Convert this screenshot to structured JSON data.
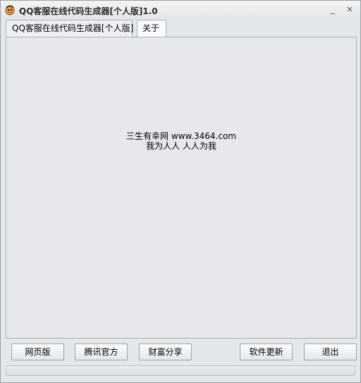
{
  "window": {
    "title": "QQ客服在线代码生成器[个人版]1.0",
    "minimize_glyph": "_",
    "close_glyph": "×"
  },
  "tabs": [
    {
      "label": "QQ客服在线代码生成器[个人版]",
      "selected": false
    },
    {
      "label": "关于",
      "selected": true
    }
  ],
  "about": {
    "line1": "三生有幸网 www.3464.com",
    "line2": "我为人人 人人为我"
  },
  "buttons": {
    "web": "网页版",
    "tencent": "腾讯官方",
    "wealth": "财富分享",
    "update": "软件更新",
    "exit": "退出"
  },
  "progress": {
    "value": 0
  },
  "icons": {
    "app": "app-logo-icon"
  }
}
